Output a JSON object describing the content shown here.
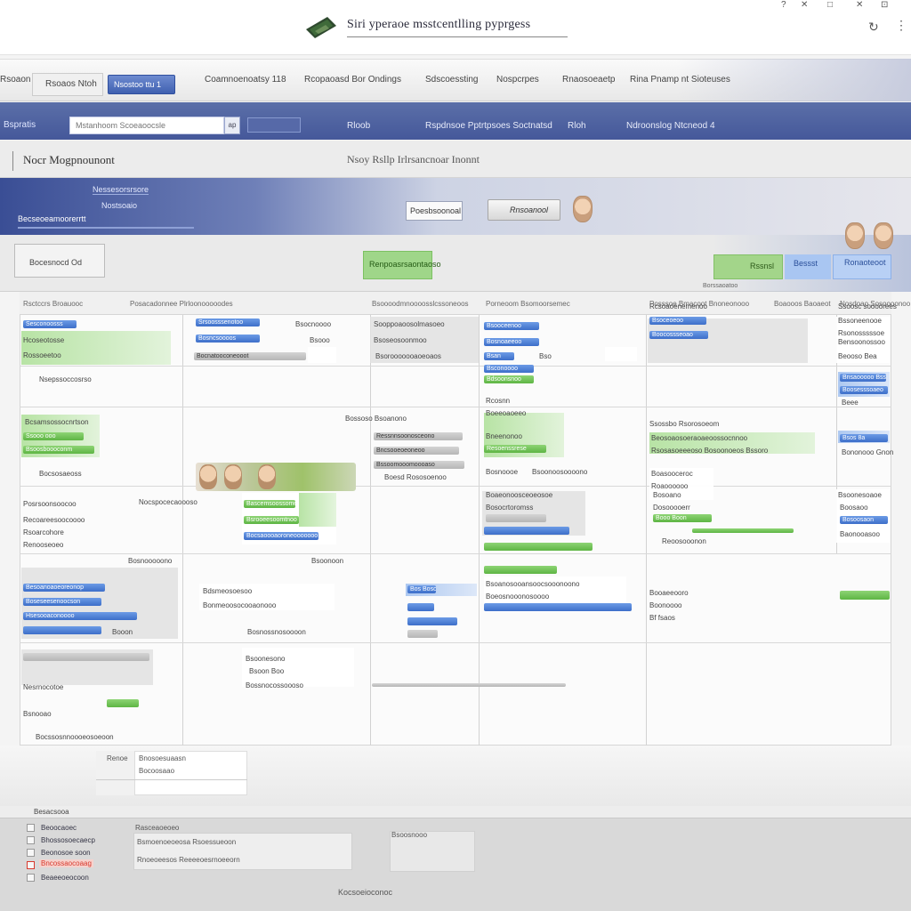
{
  "window": {
    "title": "Siri yperaoe msstcentlling pyprgess",
    "controls": [
      "?",
      "✕",
      "□",
      "✕",
      "⊡"
    ]
  },
  "tabs": {
    "field_label": "Rsoaos Ntoh",
    "active_label": "Nsostoo ttu 1",
    "items": [
      "Coamnoenoatsy 118",
      "Rcopaoasd Bor Ondings",
      "Sdscoessting",
      "Nospcrpes",
      "Rnaosoeaetp",
      "Rina Pnamp nt Sioteuses"
    ]
  },
  "nav": {
    "left_label": "Bspratis",
    "search_placeholder": "Mstanhoom Scoeaoocsle",
    "search_button": "ap",
    "links": [
      "Rloob",
      "Rspdnsoe Pptrtpsoes Soctnatsd",
      "Rloh",
      "Ndroonslog Ntcneod 4"
    ]
  },
  "heading": {
    "title": "Nocr Mogpnounont",
    "subtitle": "Nsoy Rsllp Irlrsancnoar Inonnt"
  },
  "banner": {
    "line1": "Nessesorsrsore",
    "line2": "Nostsoaio",
    "line3": "Becseoeamoorerrtt",
    "button1": "Poesbsoonoal",
    "button2": "Rnsoanool"
  },
  "toolbar": {
    "box_label": "Bocesnocd Od",
    "green_button": "Renpoasrsaontaoso",
    "right_green": "Rssnsl",
    "right_blue1": "Bessst",
    "right_blue2": "Ronaoteoot",
    "date_label": "Borssaoatoo"
  },
  "calendar": {
    "columns": [
      "Rsctccrs  Broauooc",
      "Posacadonnee  Plrloonooooodes",
      "Bsoooodmnoooosslcssoneoos",
      "Porneoom  Bsomoorsemec",
      "Posssoe  Bmacoot  Bnoneonooo",
      "Boaooos  Baoaeot",
      "Nosdoao  Sosoooonoo"
    ],
    "events": {
      "c1": [
        "Sesconoosss",
        "Hcoseotosse",
        "Rossoeetoo",
        "Nsepssoccosrso",
        "Bcsamsossocnrtson",
        "Ssooo ooo",
        "Bsoosboooconm",
        "Bocsosaeoss",
        "Posrsoonsoocoo",
        "Recoareesoocoooo",
        "Rsoarcohore",
        "Renooseoeo",
        "Besoanoaoeoreonop",
        "Boseseesenoocson",
        "Hsesooaconoooo",
        "Nesrnocotoe",
        "Bsnooao"
      ],
      "c2": [
        "Srsoosssenotoo",
        "Bsocnoooo",
        "Bosncsoooos",
        "Bocnatooconeooot",
        "Nocspocecaoooso",
        "Bascemsoossomeonooassooo",
        "Bsrooeesoomtnoo",
        "Bocsaoooaoroneooooooo",
        "Bdsmeosoesoo",
        "Bonmeoosocooaonooo"
      ],
      "c3": [
        "Sooppoaoosolmasoeo",
        "Bsoseosoonmoo",
        "Bsorooooooaoeoaos",
        "Bossoso  Bsoanono",
        "Ressnnsoonosceono",
        "Bncsooeoeoneoo",
        "Bssoomooomoooaso",
        "Boesd Rososoenoo",
        "Bos Boson"
      ],
      "c4": [
        "Bsooceenoo",
        "Bosnoaeeoo",
        "Bsan",
        "Bsconoooo",
        "Bdsoonsnoo",
        "Rcosnn",
        "Boeeoaoeeo",
        "Bneenonoo",
        "Resoenssrese",
        "Bosnoooe",
        "Boaeonoosceoeosoe",
        "Bosocrtoromss"
      ],
      "c5": [
        "Rcsoaoenemenoo",
        "Bsoceoeoo",
        "Boocossseoao",
        "Ssossbo  Rsorosoeom",
        "Beosoaosoeraoaeoossocnnoo",
        "Rsosasoeeeoso  Bosoonoeos  Bssoro",
        "Boasooceroc",
        "Roaoooooo",
        "Bosoano",
        "Dosooooerr",
        "Booo Boon",
        "Reoosooonon",
        "Booaeeooro",
        "Bf fsaos"
      ],
      "c6": [
        "Ssoosc soooorees",
        "Bssoneenooe",
        "Rsonosssssoe",
        "Bensoonossoo",
        "Beooso Bea",
        "Bnsaooooo Bss",
        "Boosesssoaeo",
        "Beee",
        "Bsos 8a",
        "Bononooo Gnon",
        "Bsoonesoaoe",
        "Boosaoo",
        "Bosoosaon",
        "Baonooasoo"
      ]
    }
  },
  "lower_panel": {
    "lines": [
      "Renoe",
      "Bnosoesuaasn",
      "Bocoosaao"
    ]
  },
  "bottom": {
    "title": "Besacsooa",
    "rows": [
      "Beoocaoec",
      "Bhossosoecaecp",
      "Beonosoe soon",
      "Bncossaocoaag",
      "Beaeeoeocoon"
    ],
    "card1_lines": [
      "Rasceaoeoeo",
      "Bsmoenoeoeosa  Rsoessueoon",
      "Rnoeoeesos  Reeeeoesrnoeeorn"
    ],
    "card2_label": "Bsoosnooo",
    "footer": "Kocsoeioconoc"
  },
  "colors": {
    "nav_blue": "#4b5e9f",
    "event_blue": "#4f80d6",
    "event_green": "#6cc052",
    "alert_red": "#d83a2e"
  }
}
